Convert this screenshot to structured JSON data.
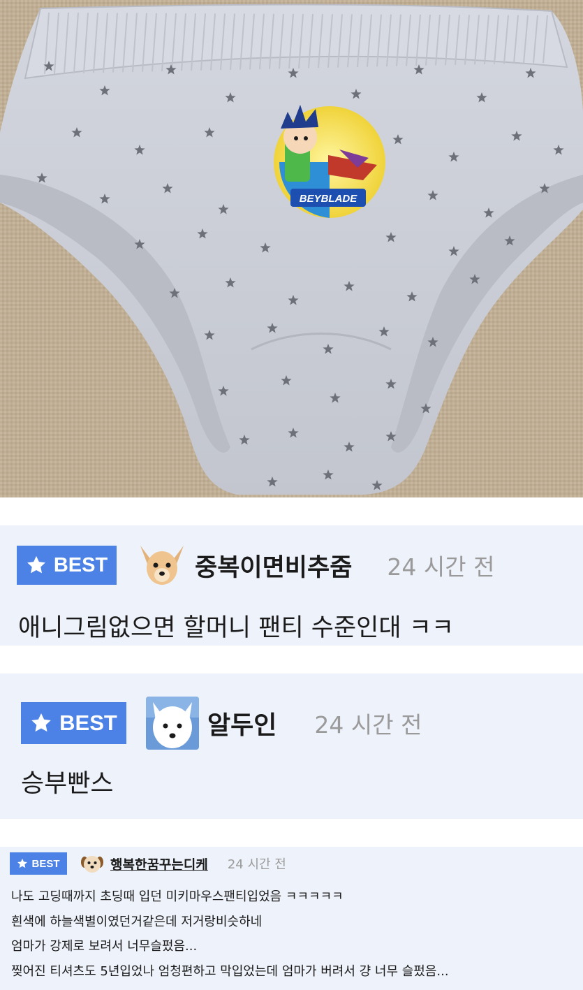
{
  "photo": {
    "logo_text": "BEYBLADE",
    "background_color": "#bfae94",
    "fabric_color": "#cdd0d9",
    "star_color": "#6d7079"
  },
  "colors": {
    "badge": "#4c82e6",
    "card_background": "#eef2fa",
    "time_text": "#9a9a9a"
  },
  "comments": [
    {
      "badge_label": "BEST",
      "badge_icon": "star-icon",
      "avatar_icon": "chihuahua-avatar-icon",
      "nickname": "중복이면비추줌",
      "time": "24 시간 전",
      "lines": [
        "애니그림없으면 할머니 팬티 수준인대 ㅋㅋ"
      ]
    },
    {
      "badge_label": "BEST",
      "badge_icon": "star-icon",
      "avatar_icon": "white-dog-avatar-icon",
      "nickname": "알두인",
      "time": "24 시간 전",
      "lines": [
        "승부빤스"
      ]
    },
    {
      "badge_label": "BEST",
      "badge_icon": "star-icon",
      "avatar_icon": "dog-avatar-icon",
      "nickname": "행복한꿈꾸는디케",
      "time": "24 시간 전",
      "lines": [
        "나도 고딩때까지 초딩때 입던 미키마우스팬티입었음 ㅋㅋㅋㅋㅋ",
        "흰색에 하늘색별이였던거같은데 저거랑비슷하네",
        "엄마가 강제로 보려서 너무슬펐음...",
        "찢어진 티셔츠도 5년입었나 엄청편하고 막입었는데 엄마가 버려서 걍 너무 슬펐음..."
      ]
    }
  ]
}
